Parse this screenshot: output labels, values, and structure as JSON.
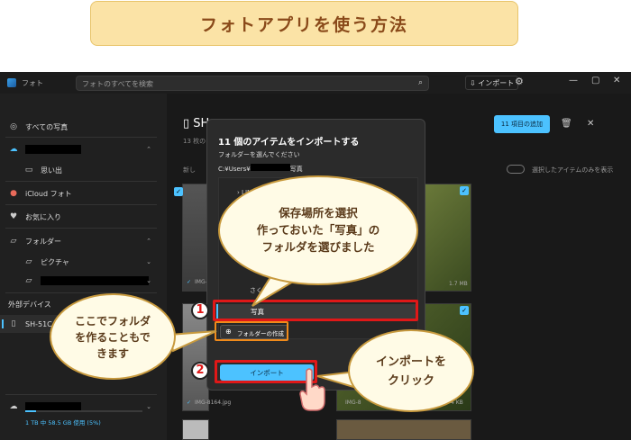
{
  "banner": {
    "title": "フォトアプリを使う方法"
  },
  "app": {
    "title": "フォト",
    "search_placeholder": "フォトのすべてを検索",
    "import_label": "インポート",
    "window_controls": [
      "—",
      "▢",
      "✕"
    ]
  },
  "sidebar": {
    "all_photos": "すべての写真",
    "memories": "思い出",
    "icloud": "iCloud フォト",
    "favorites": "お気に入り",
    "folders": "フォルダー",
    "pictures": "ピクチャ",
    "external_devices": "外部デバイス",
    "device": "SH-51C",
    "storage_text": "1 TB 中 58.5 GB 使用 (5%)",
    "storage_fraction": 0.058
  },
  "main": {
    "header_title": "SH",
    "header_count": "13 枚の",
    "new_label": "新し",
    "add_button": "11 項目の追加",
    "toggle_label": "選択したアイテムのみを表示",
    "photo1_name": "IMG-",
    "photo1_size": "1.7 MB",
    "photo2_name": "IMG-8164.jpg",
    "photo3_name": "IMG-8",
    "photo3_size": "4 KB"
  },
  "dialog": {
    "title": "11 個のアイテムをインポートする",
    "subtitle": "フォルダーを選んでください",
    "path_prefix": "C:¥Users¥",
    "path_suffix": "写真",
    "tree_item1": "LINE",
    "tree_item2": "さく",
    "selected_folder": "写真",
    "new_folder_button": "フォルダーの作成",
    "import_button": "インポート"
  },
  "annotations": {
    "callout_main": "保存場所を選択\n作っておいた「写真」の\nフォルダを選びました",
    "callout_left": "ここでフォルダ\nを作ることもで\nきます",
    "callout_right": "インポートを\nクリック",
    "num1": "1",
    "num2": "2"
  },
  "colors": {
    "accent": "#4cc2ff",
    "highlight": "#e01818",
    "banner_bg": "#fbe3a6"
  }
}
